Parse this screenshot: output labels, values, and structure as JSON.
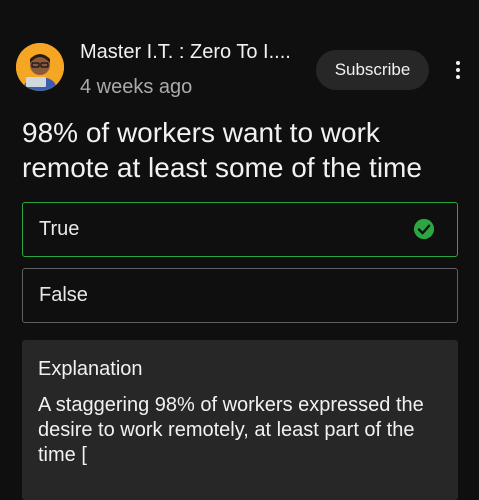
{
  "post": {
    "channel_name": "Master I.T. : Zero To I....",
    "timestamp": "4 weeks ago",
    "subscribe_label": "Subscribe",
    "more_icon": "more-vertical-icon"
  },
  "quiz": {
    "question": "98% of workers want to work remote at least some of the time",
    "options": [
      {
        "label": "True",
        "state": "correct"
      },
      {
        "label": "False",
        "state": "unselected"
      }
    ],
    "correct_icon": "check-circle-icon",
    "correct_color": "#2ba640"
  },
  "explanation": {
    "title": "Explanation",
    "body": "A staggering 98% of workers expressed the desire to work remotely, at least part of the time ["
  },
  "colors": {
    "background": "#0f0f0f",
    "surface": "#272727",
    "accent_green": "#2ba640",
    "avatar_bg": "#f5a623"
  }
}
